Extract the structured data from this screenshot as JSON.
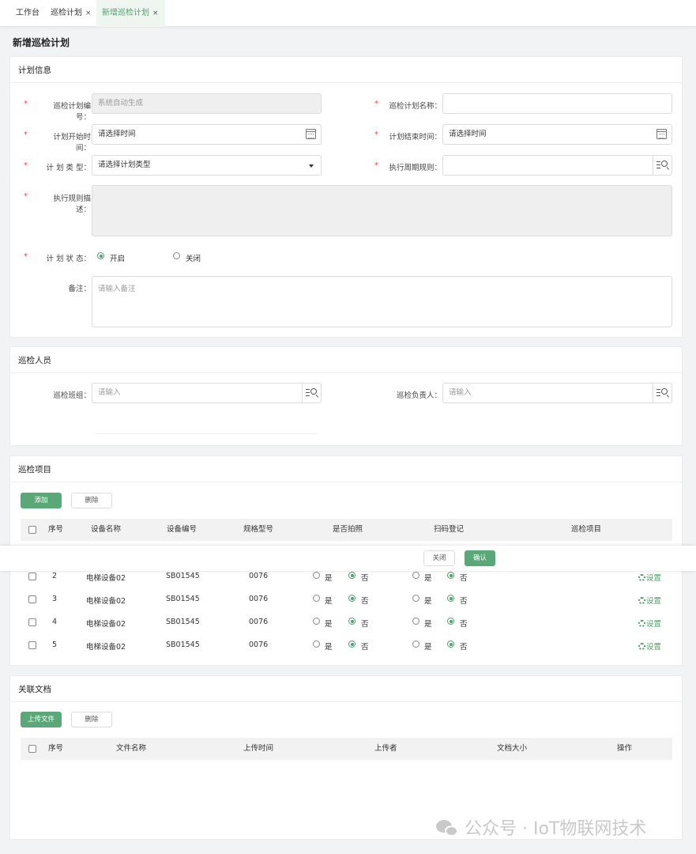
{
  "tabs": [
    {
      "label": "工作台"
    },
    {
      "label": "巡检计划",
      "close": "×"
    },
    {
      "label": "新增巡检计划",
      "close": "×"
    }
  ],
  "page_title": "新增巡检计划",
  "plan_info": {
    "title": "计划信息",
    "required_mark": "*",
    "plan_no": {
      "label": "巡检计划编号：",
      "value": "系统自动生成"
    },
    "plan_name": {
      "label": "巡检计划名称：",
      "value": ""
    },
    "start_time": {
      "label": "计划开始时间：",
      "value": "请选择时间"
    },
    "end_time": {
      "label": "计划结束时间：",
      "value": "请选择时间"
    },
    "plan_type": {
      "label": "计 划 类 型：",
      "value": "请选择计划类型"
    },
    "cycle_rule": {
      "label": "执行周期规则：",
      "value": ""
    },
    "rule_desc": {
      "label": "执行规则描述："
    },
    "status": {
      "label": "计 划 状 态：",
      "options": [
        "开启",
        "关闭"
      ],
      "selected": "开启"
    },
    "remark": {
      "label": "备注：",
      "placeholder": "请输入备注"
    }
  },
  "personnel": {
    "title": "巡检人员",
    "team": {
      "label": "巡检班组：",
      "placeholder": "请输入"
    },
    "leader": {
      "label": "巡检负责人：",
      "placeholder": "请输入"
    }
  },
  "items": {
    "title": "巡检项目",
    "add_label": "添加",
    "delete_label": "删除",
    "columns": [
      "序号",
      "设备名称",
      "设备编号",
      "规格型号",
      "是否拍照",
      "扫码登记",
      "巡检项目"
    ],
    "yes_label": "是",
    "no_label": "否",
    "settings_label": "设置",
    "rows": [
      {
        "no": "2",
        "name": "电梯设备02",
        "code": "SB01545",
        "model": "0076",
        "photo": "否",
        "scan": "否"
      },
      {
        "no": "3",
        "name": "电梯设备02",
        "code": "SB01545",
        "model": "0076",
        "photo": "否",
        "scan": "否"
      },
      {
        "no": "4",
        "name": "电梯设备02",
        "code": "SB01545",
        "model": "0076",
        "photo": "否",
        "scan": "否"
      },
      {
        "no": "5",
        "name": "电梯设备02",
        "code": "SB01545",
        "model": "0076",
        "photo": "否",
        "scan": "否"
      }
    ]
  },
  "footer_bar": {
    "close_label": "关闭",
    "confirm_label": "确认"
  },
  "documents": {
    "title": "关联文档",
    "upload_label": "上传文件",
    "delete_label": "删除",
    "columns": [
      "序号",
      "文件名称",
      "上传时间",
      "上传者",
      "文档大小",
      "操作"
    ]
  },
  "watermark": {
    "text": "公众号 · IoT物联网技术"
  },
  "colors": {
    "accent": "#5aa877",
    "required": "#e14b4b",
    "page_bg": "#f2f3f5"
  }
}
